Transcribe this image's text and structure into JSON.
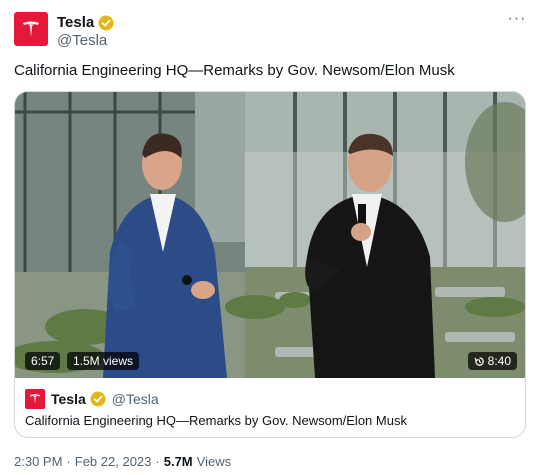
{
  "author": {
    "display_name": "Tesla",
    "handle": "@Tesla",
    "verified_badge": "gold-check-icon",
    "brand_color": "#e31937"
  },
  "more_label": "···",
  "tweet": {
    "text": "California Engineering HQ—Remarks by Gov. Newsom/Elon Musk"
  },
  "video": {
    "duration": "6:57",
    "views": "1.5M views",
    "timestamp": "8:40",
    "replay_icon": "replay-icon"
  },
  "quote_card": {
    "display_name": "Tesla",
    "handle": "@Tesla",
    "text": "California Engineering HQ—Remarks by Gov. Newsom/Elon Musk"
  },
  "meta": {
    "time": "2:30 PM",
    "date": "Feb 22, 2023",
    "separator": "·",
    "views_count": "5.7M",
    "views_label": "Views"
  },
  "colors": {
    "text_primary": "#0f1419",
    "text_secondary": "#536471",
    "border": "#cfd9de",
    "gold_badge": "#e2b719"
  }
}
